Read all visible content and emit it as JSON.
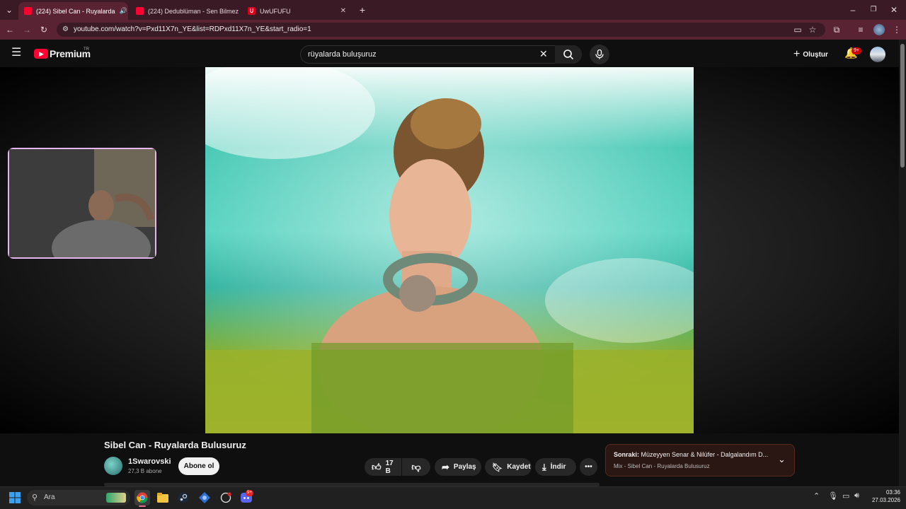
{
  "browser": {
    "tabs": [
      {
        "label": "(224) Sibel Can - Ruyalarda",
        "favicon_color": "#ff0033",
        "active": true,
        "audio": true
      },
      {
        "label": "(224) Dedublüman - Sen Bilmez",
        "favicon_color": "#ff0033",
        "active": false
      },
      {
        "label": "UwUFUFU",
        "favicon_color": "#d6001c",
        "favicon_letter": "U",
        "active": false
      }
    ],
    "new_tab_label": "+",
    "url": "youtube.com/watch?v=Pxd11X7n_YE&list=RDPxd11X7n_YE&start_radio=1"
  },
  "youtube": {
    "logo_text": "Premium",
    "logo_region": "TR",
    "search_value": "rüyalarda buluşuruz",
    "create_label": "Oluştur",
    "notification_badge": "9+",
    "video": {
      "title": "Sibel Can - Ruyalarda Bulusuruz",
      "channel": "1Swarovski",
      "subscribers": "27,3 B abone",
      "subscribe_label": "Abone ol",
      "likes": "17 B",
      "share_label": "Paylaş",
      "save_label": "Kaydet",
      "download_label": "İndir"
    },
    "up_next": {
      "prefix": "Sonraki:",
      "title": "Müzeyyen Senar & Nilüfer - Dalgalandım D...",
      "subtitle": "Mix - Sibel Can - Ruyalarda Bulusuruz"
    }
  },
  "taskbar": {
    "search_placeholder": "Ara",
    "discord_badge": "9+",
    "time": "03:36",
    "date": "27.03.2026"
  },
  "colors": {
    "accent": "#ff0033",
    "tab_strip": "#3a1a24",
    "toolbar": "#5a2334"
  }
}
